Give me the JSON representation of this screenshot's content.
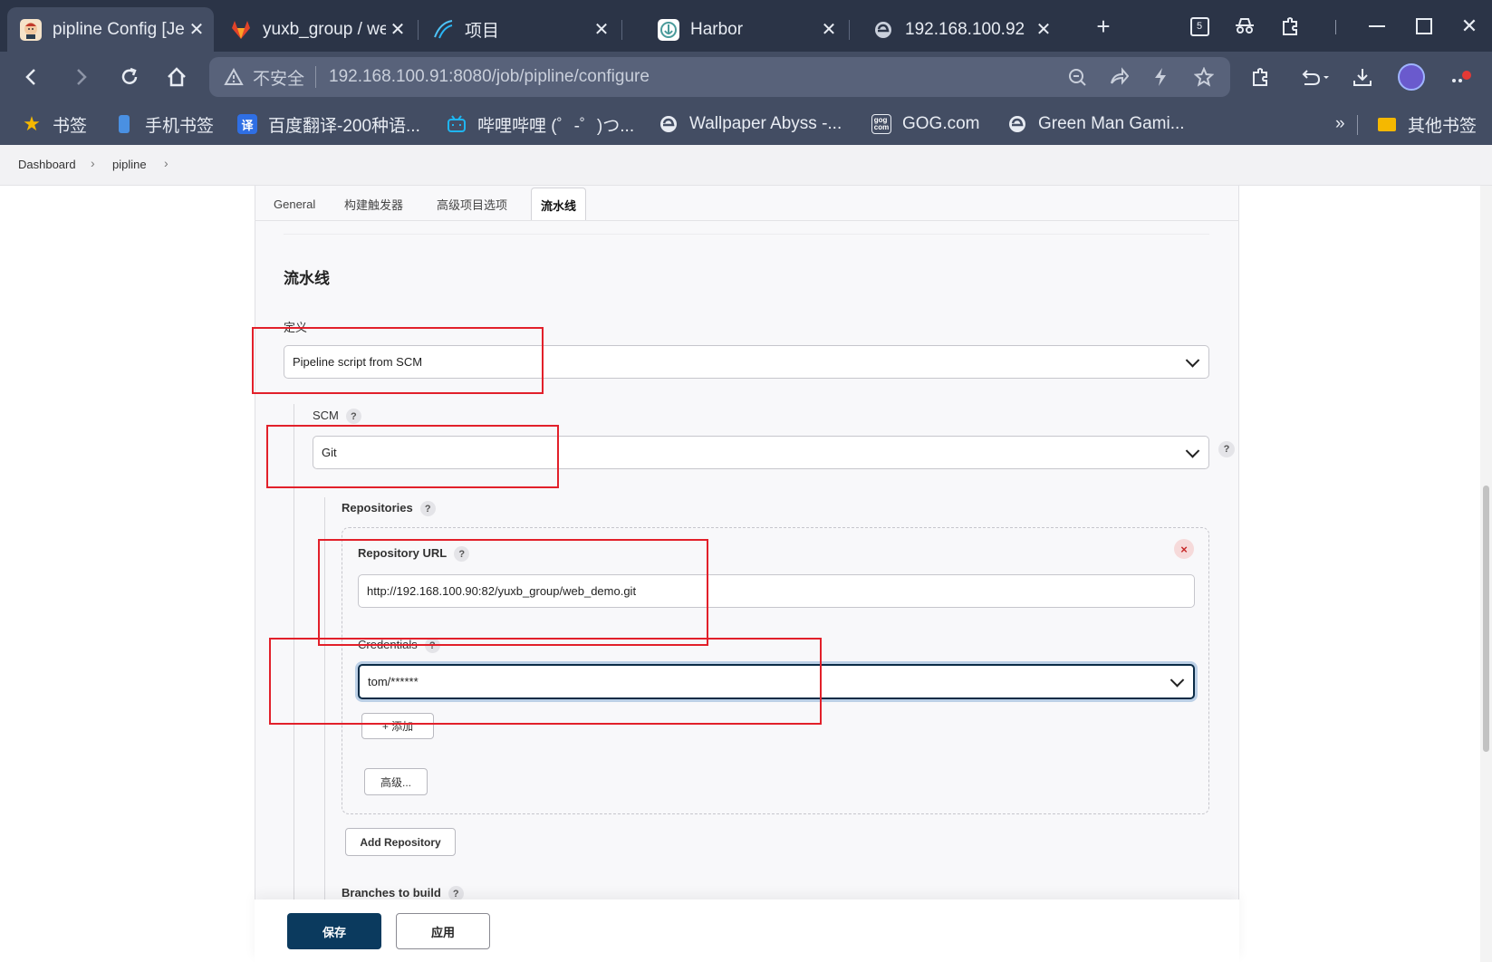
{
  "browser": {
    "tabs": [
      {
        "title": "pipline Config [Je",
        "active": true
      },
      {
        "title": "yuxb_group / wel",
        "active": false
      },
      {
        "title": "项目",
        "active": false
      },
      {
        "title": "Harbor",
        "active": false
      },
      {
        "title": "192.168.100.92",
        "active": false
      }
    ],
    "tab_counter": "5",
    "address": {
      "security_label": "不安全",
      "url": "192.168.100.91:8080/job/pipline/configure"
    },
    "bookmarks": [
      {
        "label": "书签"
      },
      {
        "label": "手机书签"
      },
      {
        "label": "百度翻译-200种语..."
      },
      {
        "label": "哔哩哔哩 (゜-゜)つ..."
      },
      {
        "label": "Wallpaper Abyss -..."
      },
      {
        "label": "GOG.com"
      },
      {
        "label": "Green Man Gami..."
      }
    ],
    "bookmarks_overflow": "»",
    "other_bookmarks": "其他书签"
  },
  "breadcrumb": {
    "items": [
      "Dashboard",
      "pipline"
    ]
  },
  "config_tabs": [
    "General",
    "构建触发器",
    "高级项目选项",
    "流水线"
  ],
  "pipeline": {
    "section_title": "流水线",
    "definition_label": "定义",
    "definition_value": "Pipeline script from SCM",
    "scm_label": "SCM",
    "scm_value": "Git",
    "repositories_label": "Repositories",
    "repo_url_label": "Repository URL",
    "repo_url_value": "http://192.168.100.90:82/yuxb_group/web_demo.git",
    "credentials_label": "Credentials",
    "credentials_value": "tom/******",
    "add_credential_label": "+ 添加",
    "advanced_label": "高级...",
    "add_repository_label": "Add Repository",
    "branches_label": "Branches to build",
    "help_glyph": "?",
    "delete_glyph": "×"
  },
  "actions": {
    "save_label": "保存",
    "apply_label": "应用"
  },
  "colors": {
    "annotation_red": "#e2202a",
    "jenkins_primary": "#0b3a5e",
    "chrome_bg": "#2b3447"
  }
}
